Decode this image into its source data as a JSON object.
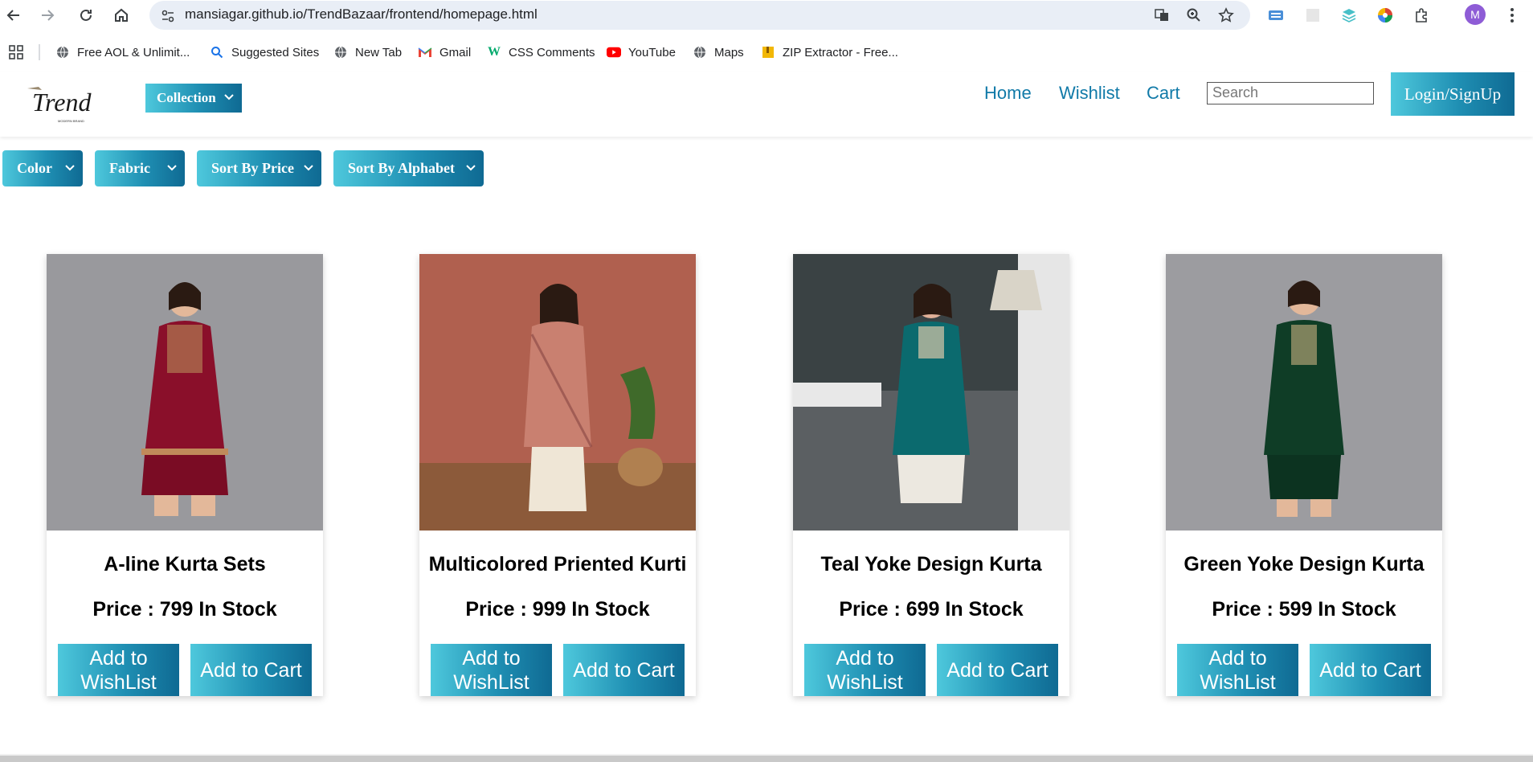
{
  "browser": {
    "url": "mansiagar.github.io/TrendBazaar/frontend/homepage.html",
    "bookmarks": [
      {
        "label": "Free AOL & Unlimit...",
        "icon": "globe-icon"
      },
      {
        "label": "Suggested Sites",
        "icon": "search-icon"
      },
      {
        "label": "New Tab",
        "icon": "globe-icon"
      },
      {
        "label": "Gmail",
        "icon": "gmail-icon"
      },
      {
        "label": "CSS Comments",
        "icon": "w3-icon"
      },
      {
        "label": "YouTube",
        "icon": "youtube-icon"
      },
      {
        "label": "Maps",
        "icon": "globe-icon"
      },
      {
        "label": "ZIP Extractor - Free...",
        "icon": "zip-icon"
      }
    ],
    "profile_initial": "M"
  },
  "header": {
    "logo_text": "Trend",
    "logo_sub": "MODERN BRAND",
    "collection_label": "Collection",
    "nav": [
      "Home",
      "Wishlist",
      "Cart"
    ],
    "search_placeholder": "Search",
    "login_label": "Login/SignUp"
  },
  "filters": [
    "Color",
    "Fabric",
    "Sort By Price",
    "Sort By Alphabet"
  ],
  "products": [
    {
      "name": "A-line Kurta Sets",
      "price_line": "Price : 799 In Stock",
      "wishlist_label": "Add to WishList",
      "cart_label": "Add to Cart"
    },
    {
      "name": "Multicolored Priented Kurti",
      "price_line": "Price : 999 In Stock",
      "wishlist_label": "Add to WishList",
      "cart_label": "Add to Cart"
    },
    {
      "name": "Teal Yoke Design Kurta",
      "price_line": "Price : 699 In Stock",
      "wishlist_label": "Add to WishList",
      "cart_label": "Add to Cart"
    },
    {
      "name": "Green Yoke Design Kurta",
      "price_line": "Price : 599 In Stock",
      "wishlist_label": "Add to WishList",
      "cart_label": "Add to Cart"
    }
  ],
  "colors": {
    "accent_start": "#4ec8dc",
    "accent_end": "#0f6a93",
    "nav_link": "#117aa8"
  }
}
